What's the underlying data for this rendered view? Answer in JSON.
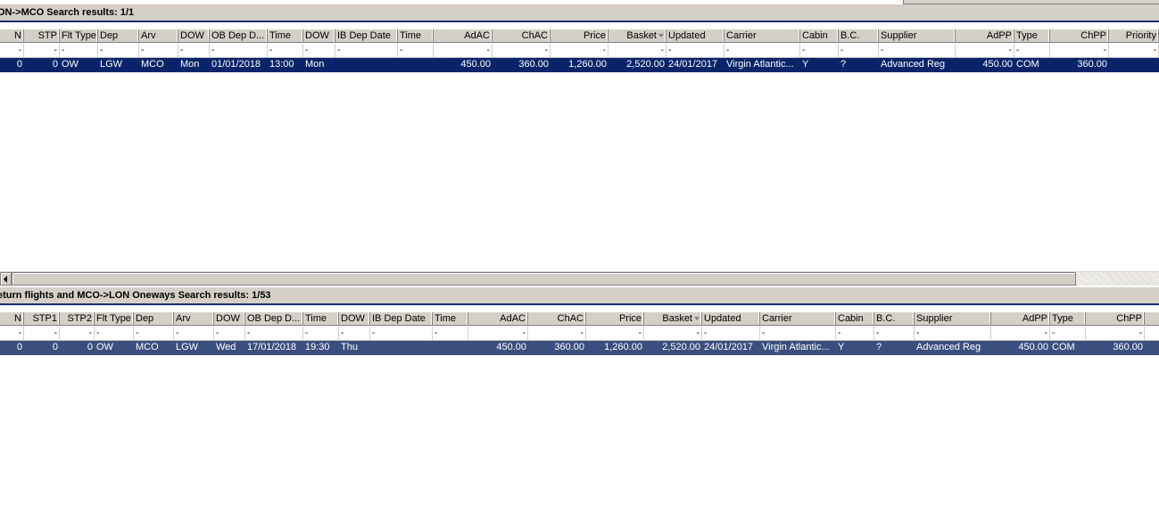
{
  "panel1": {
    "title": "ON->MCO Search results: 1/1",
    "headers": [
      "N",
      "STP",
      "Flt Type",
      "Dep",
      "Arv",
      "DOW",
      "OB Dep D...",
      "Time",
      "DOW",
      "IB Dep Date",
      "Time",
      "AdAC",
      "ChAC",
      "Price",
      "Basket",
      "Updated",
      "Carrier",
      "Cabin",
      "B.C.",
      "Supplier",
      "AdPP",
      "Type",
      "ChPP",
      "Priority"
    ],
    "filters": [
      "-",
      "-",
      "-",
      "-",
      "-",
      "-",
      "-",
      "-",
      "-",
      "-",
      "-",
      "-",
      "-",
      "-",
      "-",
      "-",
      "-",
      "-",
      "-",
      "-",
      "-",
      "-",
      "-",
      "-"
    ],
    "rows": [
      [
        "0",
        "0",
        "OW",
        "LGW",
        "MCO",
        "Mon",
        "01/01/2018",
        "13:00",
        "Mon",
        "",
        "",
        "450.00",
        "360.00",
        "1,260.00",
        "2,520.00",
        "24/01/2017",
        "Virgin Atlantic...",
        "Y",
        "?",
        "Advanced Reg",
        "450.00",
        "COM",
        "360.00",
        ""
      ]
    ]
  },
  "panel2": {
    "title": "eturn flights and MCO->LON Oneways Search results: 1/53",
    "headers": [
      "N",
      "STP1",
      "STP2",
      "Flt Type",
      "Dep",
      "Arv",
      "DOW",
      "OB Dep D...",
      "Time",
      "DOW",
      "IB Dep Date",
      "Time",
      "AdAC",
      "ChAC",
      "Price",
      "Basket",
      "Updated",
      "Carrier",
      "Cabin",
      "B.C.",
      "Supplier",
      "AdPP",
      "Type",
      "ChPP"
    ],
    "filters": [
      "-",
      "-",
      "-",
      "-",
      "-",
      "-",
      "-",
      "-",
      "-",
      "-",
      "-",
      "-",
      "-",
      "-",
      "-",
      "-",
      "-",
      "-",
      "-",
      "-",
      "-",
      "-",
      "-",
      "-"
    ],
    "rows": [
      [
        "0",
        "0",
        "0",
        "OW",
        "MCO",
        "LGW",
        "Wed",
        "17/01/2018",
        "19:30",
        "Thu",
        "",
        "",
        "450.00",
        "360.00",
        "1,260.00",
        "2,520.00",
        "24/01/2017",
        "Virgin Atlantic...",
        "Y",
        "?",
        "Advanced Reg",
        "450.00",
        "COM",
        "360.00"
      ]
    ]
  },
  "colors": {
    "selected_row": "#0a246a",
    "selected_row_inactive": "#3a4f7e",
    "header_bg": "#d4d0c8"
  }
}
